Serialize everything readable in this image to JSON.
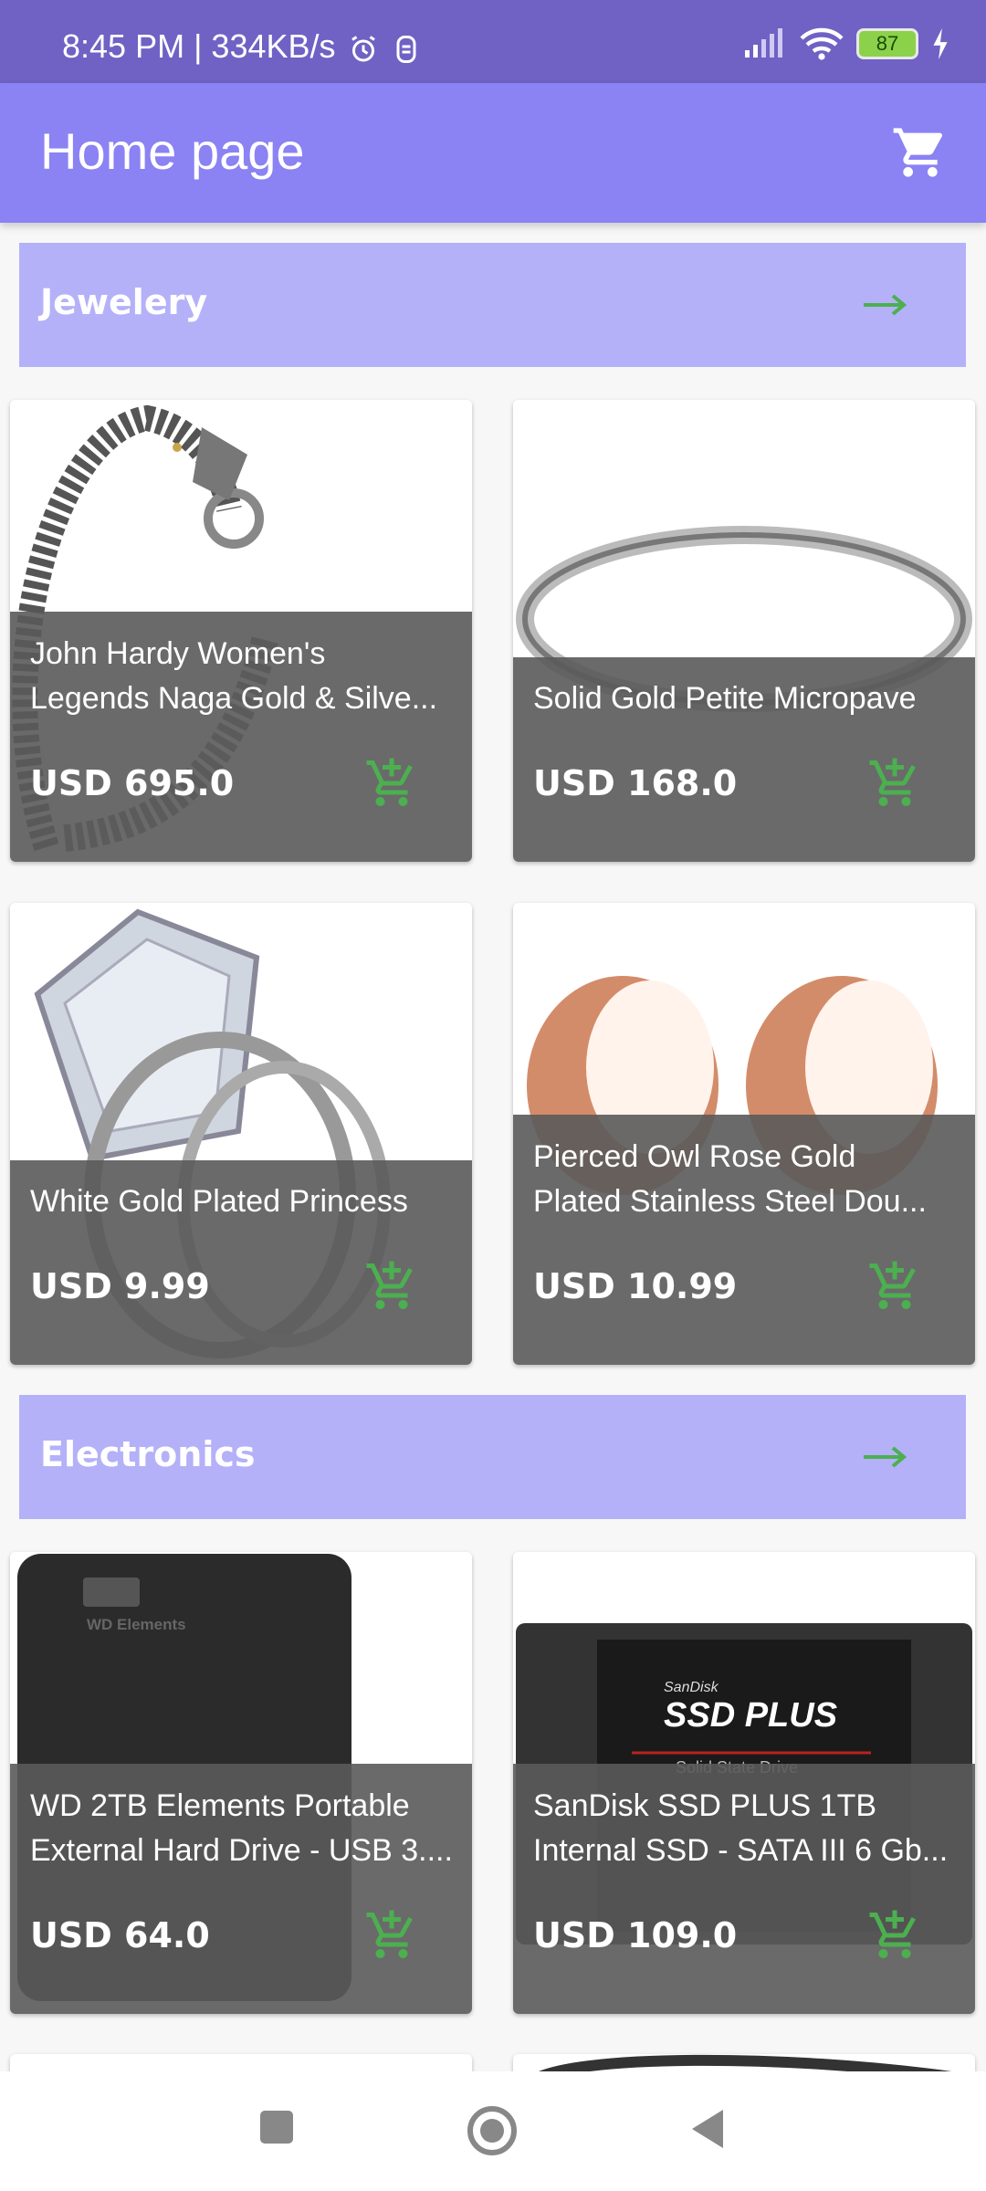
{
  "status_bar": {
    "time_text": "8:45 PM | 334KB/s",
    "battery_level": "87"
  },
  "app_bar": {
    "title": "Home page",
    "cart_icon": "shopping-cart-icon"
  },
  "sections": [
    {
      "title": "Jewelery",
      "products": [
        {
          "name_line1": "John Hardy Women's",
          "name_line2": "Legends Naga Gold & Silve...",
          "price": "USD 695.0"
        },
        {
          "name_line1": "",
          "name_line2": "Solid Gold Petite Micropave",
          "price": "USD 168.0"
        },
        {
          "name_line1": "",
          "name_line2": "White Gold Plated Princess",
          "price": "USD 9.99"
        },
        {
          "name_line1": "Pierced Owl Rose Gold",
          "name_line2": "Plated Stainless Steel Dou...",
          "price": "USD 10.99"
        }
      ]
    },
    {
      "title": "Electronics",
      "products": [
        {
          "name_line1": "WD 2TB Elements Portable",
          "name_line2": "External Hard Drive - USB 3....",
          "price": "USD 64.0",
          "image_text_brand": "WD Elements"
        },
        {
          "name_line1": "SanDisk SSD PLUS 1TB",
          "name_line2": "Internal SSD - SATA III 6 Gb...",
          "price": "USD 109.0",
          "image_text_brand": "SanDisk",
          "image_text_model": "SSD PLUS",
          "image_text_sub": "Solid State Drive"
        }
      ]
    }
  ],
  "colors": {
    "status_bar": "#6f62c4",
    "app_bar": "#8b82f3",
    "section_header": "#b4b1f8",
    "accent_green": "#4caf50",
    "overlay": "#5a5a5a"
  }
}
